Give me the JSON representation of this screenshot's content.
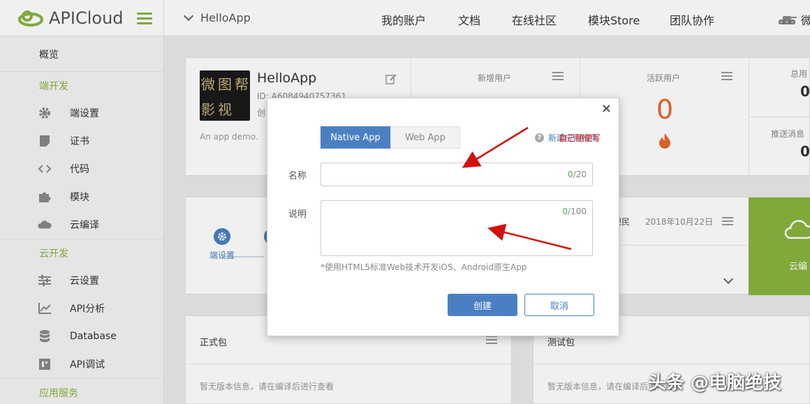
{
  "brand": {
    "name": "APICloud"
  },
  "header": {
    "app_name": "HelloApp",
    "nav": [
      "我的账户",
      "文档",
      "在线社区",
      "模块Store",
      "团队协作"
    ],
    "user_partial": "微"
  },
  "sidebar": {
    "overview": "概览",
    "sections": [
      {
        "title": "端开发",
        "items": [
          {
            "label": "端设置",
            "icon": "gear-icon"
          },
          {
            "label": "证书",
            "icon": "certificate-icon"
          },
          {
            "label": "代码",
            "icon": "code-icon"
          },
          {
            "label": "模块",
            "icon": "puzzle-icon"
          },
          {
            "label": "云编译",
            "icon": "cloud-icon"
          }
        ]
      },
      {
        "title": "云开发",
        "items": [
          {
            "label": "云设置",
            "icon": "sliders-icon"
          },
          {
            "label": "API分析",
            "icon": "chart-icon"
          },
          {
            "label": "Database",
            "icon": "database-icon"
          },
          {
            "label": "API调试",
            "icon": "debug-icon"
          }
        ]
      },
      {
        "title": "应用服务",
        "items": []
      }
    ]
  },
  "app_card": {
    "name": "HelloApp",
    "id_text": "ID: A6084940757361",
    "created_partial": "创",
    "description": "An app demo.",
    "logo_chars": [
      "微",
      "图",
      "帮",
      "影",
      "视"
    ]
  },
  "stats": [
    {
      "label": "新增用户"
    },
    {
      "label": "活跃用户",
      "value": "0"
    },
    {
      "label": "总用",
      "value": "0"
    },
    {
      "label": "推送消息",
      "value": "0"
    }
  ],
  "compile_card": {
    "step_label": "端设置",
    "author_date_partial": "师便民",
    "date": "2018年10月22日",
    "cloud_label": "云编"
  },
  "packages": {
    "formal_title": "正式包",
    "test_title": "测试包",
    "empty_text": "暂无版本信息，请在编译后进行查看"
  },
  "modal": {
    "close": "×",
    "tabs": [
      "Native App",
      "Web App"
    ],
    "active_tab": "Native App",
    "help_link": "新建应用指南",
    "help_overlay": "自己随便写",
    "name_label": "名称",
    "name_value": "",
    "name_count": "0",
    "name_max": "/20",
    "desc_label": "说明",
    "desc_value": "",
    "desc_count": "0",
    "desc_max": "/100",
    "hint": "*使用HTML5标准Web技术开发iOS、Android原生App",
    "create_button": "创建",
    "cancel_button": "取消"
  },
  "watermark": "头条 @电脑绝技",
  "colors": {
    "brand_green": "#8ab33f",
    "primary_blue": "#4a80c2",
    "annotation_red": "#d11111",
    "stat_orange": "#e8662c"
  }
}
